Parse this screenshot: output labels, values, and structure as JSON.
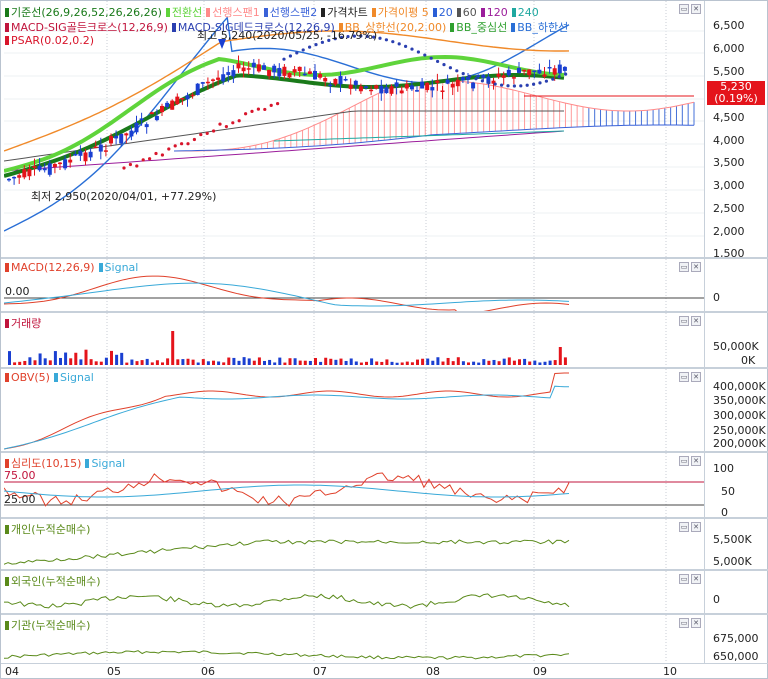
{
  "window_buttons": [
    "▭",
    "✕"
  ],
  "months": [
    "04",
    "05",
    "06",
    "07",
    "08",
    "09",
    "10"
  ],
  "main": {
    "legend": [
      {
        "label": "기준선(26,9,26,52,26,26,26)",
        "color": "#1a7a1a"
      },
      {
        "label": "전환선",
        "color": "#5fd43b"
      },
      {
        "label": "선행스팬1",
        "color": "#ff8a8a"
      },
      {
        "label": "선행스팬2",
        "color": "#3a62d8"
      },
      {
        "label": "가격차트",
        "color": "#222222"
      },
      {
        "label": "가격이평 5",
        "color": "#f08a2a"
      },
      {
        "label": "20",
        "color": "#2a5fd6"
      },
      {
        "label": "60",
        "color": "#555555"
      },
      {
        "label": "120",
        "color": "#9b1d9b"
      },
      {
        "label": "240",
        "color": "#1fa8a0"
      }
    ],
    "legend2": [
      {
        "label": "MACD-SIG골든크로스(12,26,9)",
        "color": "#c0143c"
      },
      {
        "label": "MACD-SIG데드크로스(12,26,9)",
        "color": "#2a3fb0"
      },
      {
        "label": "BB_상한선(20,2.00)",
        "color": "#f08a2a"
      },
      {
        "label": "BB_중심선",
        "color": "#2fa02f"
      },
      {
        "label": "BB_하한선",
        "color": "#2a6fd6"
      }
    ],
    "legend3": [
      {
        "label": "PSAR(0.02,0.2)",
        "color": "#d8152b"
      }
    ],
    "high_note": "최고 5,240(2020/05/25, -16.79%)",
    "low_note": "최저 2,950(2020/04/01, +77.29%)",
    "current_price": "5,230",
    "current_change": "(0.19%)",
    "y_ticks": [
      "6,500",
      "6,000",
      "5,500",
      "4,500",
      "4,000",
      "3,500",
      "3,000",
      "2,500",
      "2,000",
      "1,500"
    ]
  },
  "macd": {
    "legend": [
      {
        "label": "MACD(12,26,9)",
        "color": "#e0412b"
      },
      {
        "label": "Signal",
        "color": "#39a9d8"
      }
    ],
    "left_value": "0.00",
    "y_ticks": [
      "0"
    ]
  },
  "volume": {
    "legend": [
      {
        "label": "거래량",
        "color": "#c0143c"
      }
    ],
    "y_ticks": [
      "50,000K",
      "0K"
    ]
  },
  "obv": {
    "legend": [
      {
        "label": "OBV(5)",
        "color": "#e0412b"
      },
      {
        "label": "Signal",
        "color": "#39a9d8"
      }
    ],
    "y_ticks": [
      "400,000K",
      "350,000K",
      "300,000K",
      "250,000K",
      "200,000K"
    ]
  },
  "psy": {
    "legend": [
      {
        "label": "심리도(10,15)",
        "color": "#e0412b"
      },
      {
        "label": "Signal",
        "color": "#39a9d8"
      }
    ],
    "upper_label": "75.00",
    "lower_label": "25.00",
    "y_ticks": [
      "100",
      "50",
      "0"
    ]
  },
  "individual": {
    "legend": [
      {
        "label": "개인(누적순매수)",
        "color": "#5a8a1a"
      }
    ],
    "y_ticks": [
      "5,500K",
      "5,000K"
    ]
  },
  "foreign": {
    "legend": [
      {
        "label": "외국인(누적순매수)",
        "color": "#5a8a1a"
      }
    ],
    "y_ticks": [
      "0"
    ]
  },
  "institution": {
    "legend": [
      {
        "label": "기관(누적순매수)",
        "color": "#5a8a1a"
      }
    ],
    "y_ticks": [
      "675,000",
      "650,000"
    ]
  }
}
